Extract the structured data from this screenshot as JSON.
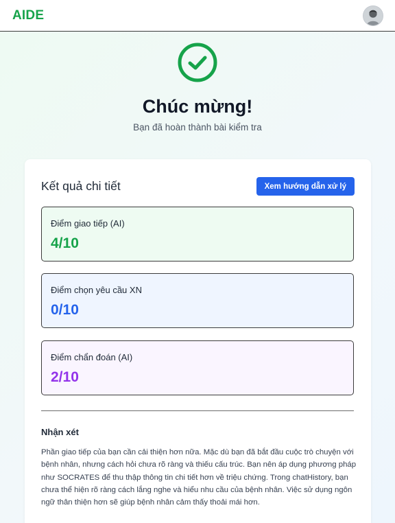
{
  "header": {
    "brand": "AIDE",
    "avatar_icon": "user-avatar-icon"
  },
  "hero": {
    "icon": "check-circle-icon",
    "icon_color": "#16a34a",
    "title": "Chúc mừng!",
    "subtitle": "Bạn đã hoàn thành bài kiểm tra"
  },
  "results": {
    "title": "Kết quả chi tiết",
    "guide_button": "Xem hướng dẫn xử lý",
    "scores": [
      {
        "label": "Điểm giao tiếp (AI)",
        "value": "4/10",
        "color": "#16a34a"
      },
      {
        "label": "Điểm chọn yêu cầu XN",
        "value": "0/10",
        "color": "#2563eb"
      },
      {
        "label": "Điểm chẩn đoán (AI)",
        "value": "2/10",
        "color": "#9333ea"
      }
    ],
    "remark_title": "Nhận xét",
    "remark_text": "Phần giao tiếp của bạn cần cải thiện hơn nữa. Mặc dù bạn đã bắt đầu cuộc trò chuyện với bệnh nhân, nhưng cách hỏi chưa rõ ràng và thiếu cấu trúc. Bạn nên áp dụng phương pháp như SOCRATES để thu thập thông tin chi tiết hơn về triệu chứng. Trong chatHistory, bạn chưa thể hiện rõ ràng cách lắng nghe và hiểu nhu cầu của bệnh nhân. Việc sử dụng ngôn ngữ thân thiện hơn sẽ giúp bệnh nhân cảm thấy thoải mái hơn."
  },
  "colors": {
    "brand": "#16a34a",
    "button": "#2563eb"
  }
}
